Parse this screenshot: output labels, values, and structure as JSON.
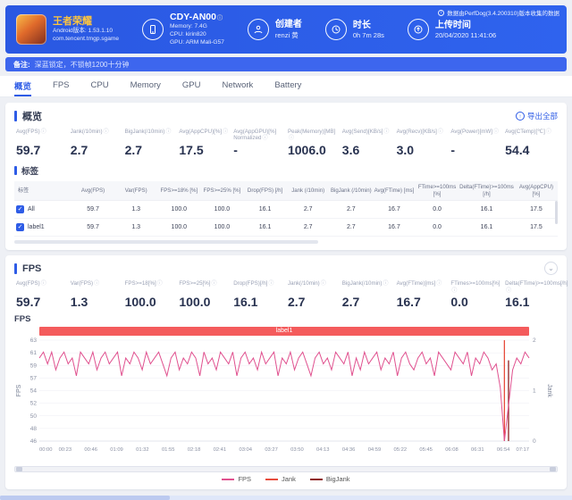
{
  "header": {
    "game": {
      "name": "王者荣耀",
      "version": "Android版本: 1.53.1.10",
      "package": "com.tencent.tmgp.sgame"
    },
    "device": {
      "model": "CDY-AN00",
      "memory": "Memory: 7.4G",
      "cpu": "CPU: kirin820",
      "gpu": "GPU: ARM Mali-G57"
    },
    "creator": {
      "label": "创建者",
      "value": "renzi 黄"
    },
    "duration": {
      "label": "时长",
      "value": "0h 7m 28s"
    },
    "upload": {
      "label": "上传时间",
      "value": "20/04/2020 11:41:06"
    },
    "collect_note": "数据由PerfDog(3.4.200310)版本收集的数据"
  },
  "note": {
    "label": "备注:",
    "text": "深蓝锁定，不锁帧1200十分钟"
  },
  "tabs": [
    {
      "key": "overview",
      "label": "概览"
    },
    {
      "key": "fps",
      "label": "FPS"
    },
    {
      "key": "cpu",
      "label": "CPU"
    },
    {
      "key": "memory",
      "label": "Memory"
    },
    {
      "key": "gpu",
      "label": "GPU"
    },
    {
      "key": "network",
      "label": "Network"
    },
    {
      "key": "battery",
      "label": "Battery"
    }
  ],
  "overview": {
    "title": "概览",
    "export_label": "导出全部",
    "metrics": [
      {
        "label": "Avg(FPS)",
        "value": "59.7"
      },
      {
        "label": "Jank(/10min)",
        "value": "2.7"
      },
      {
        "label": "BigJank(/10min)",
        "value": "2.7"
      },
      {
        "label": "Avg(AppCPU)[%]",
        "value": "17.5"
      },
      {
        "label": "Avg(AppGPU)[%] Normalized",
        "value": "-"
      },
      {
        "label": "Peak(Memory)[MB]",
        "value": "1006.0"
      },
      {
        "label": "Avg(Send)[KB/s]",
        "value": "3.6"
      },
      {
        "label": "Avg(Recv)[KB/s]",
        "value": "3.0"
      },
      {
        "label": "Avg(Power)[mW]",
        "value": "-"
      },
      {
        "label": "Avg(CTemp)[℃]",
        "value": "54.4"
      }
    ],
    "table_title": "标签",
    "table": {
      "columns": [
        "标签",
        "Avg(FPS)",
        "Var(FPS)",
        "FPS>=18% [%]",
        "FPS>=25% [%]",
        "Drop(FPS) [/h]",
        "Jank (/10min)",
        "BigJank (/10min)",
        "Avg(FTime) [ms]",
        "FTime>=100ms [%]",
        "Delta(FTime)>=100ms [/h]",
        "Avg(AppCPU) [%]"
      ],
      "rows": [
        {
          "label": "All",
          "checked": true,
          "values": [
            "59.7",
            "1.3",
            "100.0",
            "100.0",
            "16.1",
            "2.7",
            "2.7",
            "16.7",
            "0.0",
            "16.1",
            "17.5"
          ]
        },
        {
          "label": "label1",
          "checked": true,
          "values": [
            "59.7",
            "1.3",
            "100.0",
            "100.0",
            "16.1",
            "2.7",
            "2.7",
            "16.7",
            "0.0",
            "16.1",
            "17.5"
          ]
        }
      ]
    }
  },
  "fps_section": {
    "title": "FPS",
    "chart_label": "FPS",
    "metrics": [
      {
        "label": "Avg(FPS)",
        "value": "59.7"
      },
      {
        "label": "Var(FPS)",
        "value": "1.3"
      },
      {
        "label": "FPS>=18[%]",
        "value": "100.0"
      },
      {
        "label": "FPS>=25[%]",
        "value": "100.0"
      },
      {
        "label": "Drop(FPS)[/h]",
        "value": "16.1"
      },
      {
        "label": "Jank(/10min)",
        "value": "2.7"
      },
      {
        "label": "BigJank(/10min)",
        "value": "2.7"
      },
      {
        "label": "Avg(FTime)[ms]",
        "value": "16.7"
      },
      {
        "label": "FTimes>=100ms[%]",
        "value": "0.0"
      },
      {
        "label": "Delta(FTime)>=100ms[/h]",
        "value": "16.1"
      }
    ]
  },
  "chart_data": {
    "type": "line",
    "title": "FPS",
    "banner": "label1",
    "xlabel": "",
    "ylabel_left": "FPS",
    "ylabel_right": "Jank",
    "ylim_left": [
      46,
      63
    ],
    "ylim_right": [
      0,
      2
    ],
    "y_ticks_left": [
      63,
      61,
      59,
      57,
      54,
      52,
      50,
      48,
      46
    ],
    "y_ticks_right": [
      2,
      1,
      0
    ],
    "x_ticks": [
      "00:00",
      "00:23",
      "00:46",
      "01:09",
      "01:32",
      "01:55",
      "02:18",
      "02:41",
      "03:04",
      "03:27",
      "03:50",
      "04:13",
      "04:36",
      "04:59",
      "05:22",
      "05:45",
      "06:08",
      "06:31",
      "06:54",
      "07:17"
    ],
    "grid": true,
    "legend_position": "bottom",
    "series": [
      {
        "name": "FPS",
        "color": "#e0518f",
        "type": "line",
        "values": [
          60,
          61,
          59,
          61,
          58,
          60,
          61,
          59,
          60,
          57,
          61,
          60,
          59,
          61,
          58,
          60,
          61,
          59,
          60,
          61,
          57,
          60,
          59,
          61,
          60,
          58,
          61,
          59,
          60,
          61,
          59,
          57,
          60,
          61,
          58,
          60,
          59,
          61,
          60,
          57,
          61,
          59,
          60,
          58,
          61,
          60,
          59,
          61,
          57,
          60,
          61,
          59,
          60,
          58,
          61,
          59,
          60,
          61,
          57,
          60,
          59,
          61,
          58,
          60,
          61,
          59,
          57,
          60,
          61,
          59,
          60,
          58,
          61,
          60,
          59,
          61,
          57,
          60,
          58,
          61,
          59,
          60,
          61,
          58,
          60,
          59,
          61,
          57,
          60,
          61,
          59,
          58,
          60,
          61,
          59,
          60,
          57,
          61,
          60,
          59,
          58,
          61,
          60,
          59,
          61,
          57,
          60,
          59,
          61,
          60,
          58,
          59,
          55,
          46,
          52,
          58,
          60,
          59,
          61,
          60
        ]
      },
      {
        "name": "Jank",
        "color": "#e74c3c",
        "type": "spike",
        "points": [
          {
            "i": 113,
            "v": 2
          }
        ]
      },
      {
        "name": "BigJank",
        "color": "#8e1f1f",
        "type": "spike",
        "points": [
          {
            "i": 114,
            "v": 1.6
          }
        ]
      }
    ]
  }
}
